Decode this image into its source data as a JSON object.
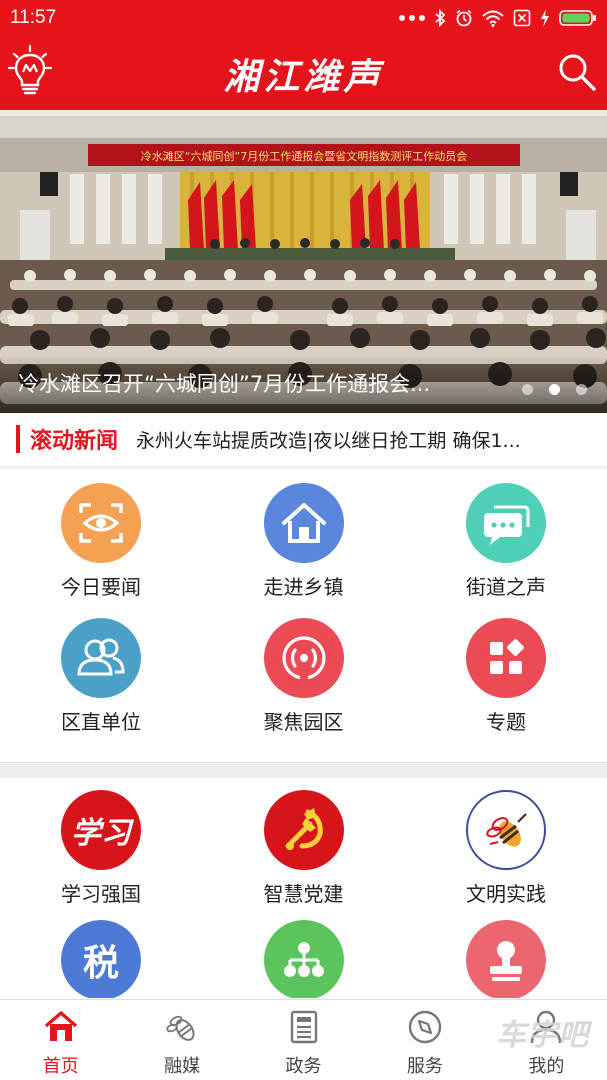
{
  "status_bar": {
    "time": "11:57"
  },
  "header": {
    "title": "湘江潍声",
    "icons": [
      "lightbulb-icon",
      "search-icon"
    ]
  },
  "banner": {
    "backdrop_text": "冷水滩区“六城同创”7月份工作通报会暨省文明指数测评工作动员会",
    "caption": "冷水滩区召开“六城同创”7月份工作通报会...",
    "slide_count": 3,
    "active_slide": 2
  },
  "ticker": {
    "label": "滚动新闻",
    "text": "永州火车站提质改造|夜以继日抢工期 确保1..."
  },
  "grid1": [
    {
      "label": "今日要闻",
      "icon": "eye-scan-icon",
      "color": "#f4a153"
    },
    {
      "label": "走进乡镇",
      "icon": "house-icon",
      "color": "#5b86de"
    },
    {
      "label": "街道之声",
      "icon": "chat-bubbles-icon",
      "color": "#4fcfb6"
    },
    {
      "label": "区直单位",
      "icon": "people-icon",
      "color": "#4ba0c8"
    },
    {
      "label": "聚焦园区",
      "icon": "broadcast-icon",
      "color": "#ec4b55"
    },
    {
      "label": "专题",
      "icon": "apps-icon",
      "color": "#ec4b55"
    }
  ],
  "grid2": [
    {
      "label": "学习强国",
      "icon": "xuexi-logo-icon",
      "color": "#d8141b"
    },
    {
      "label": "智慧党建",
      "icon": "party-emblem-icon",
      "color": "#d8141b"
    },
    {
      "label": "文明实践",
      "icon": "bee-logo-icon",
      "color": "#ffffff"
    },
    {
      "label": "",
      "icon": "tax-icon",
      "glyph": "税",
      "color": "#4d7ad4"
    },
    {
      "label": "",
      "icon": "org-chart-icon",
      "color": "#5cc45c"
    },
    {
      "label": "",
      "icon": "stamp-icon",
      "color": "#ec6670"
    }
  ],
  "bottom_nav": [
    {
      "label": "首页",
      "icon": "home-icon",
      "active": true
    },
    {
      "label": "融媒",
      "icon": "bee-icon",
      "active": false
    },
    {
      "label": "政务",
      "icon": "document-icon",
      "active": false
    },
    {
      "label": "服务",
      "icon": "compass-icon",
      "active": false
    },
    {
      "label": "我的",
      "icon": "user-icon",
      "active": false
    }
  ],
  "watermark": "车宇吧"
}
